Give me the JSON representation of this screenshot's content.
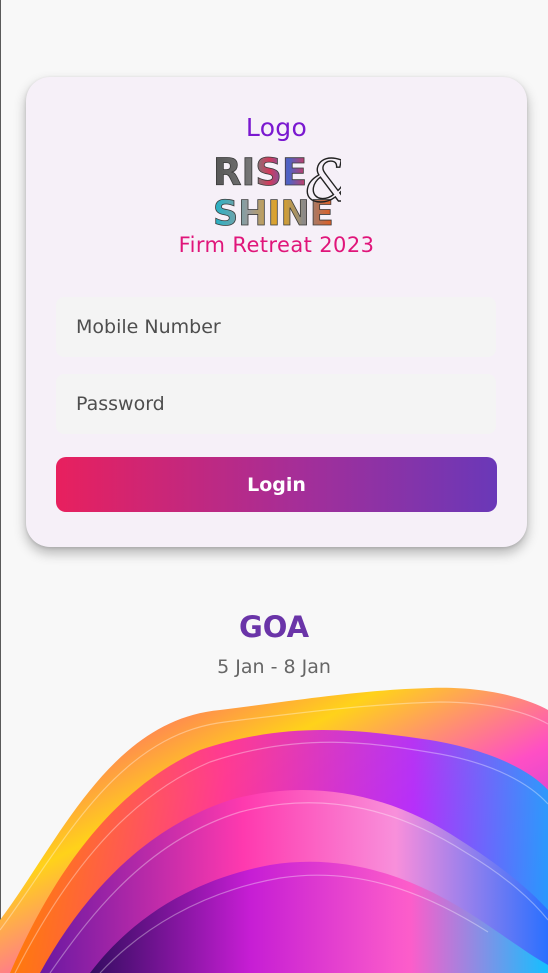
{
  "brand": {
    "logo_text": "Logo",
    "logo_word_1": "RISE",
    "logo_word_2": "SHINE",
    "logo_ampersand": "&",
    "event_title": "Firm Retreat 2023"
  },
  "login_form": {
    "mobile_placeholder": "Mobile Number",
    "mobile_value": "",
    "password_placeholder": "Password",
    "password_value": "",
    "login_label": "Login"
  },
  "event": {
    "location": "GOA",
    "dates": "5 Jan - 8 Jan"
  },
  "colors": {
    "logo_text": "#7a18d0",
    "event_title": "#e0157a",
    "location": "#6a34a8",
    "button_start": "#e8205e",
    "button_end": "#6a38b8"
  },
  "decoration": {
    "background_art": "colorful-abstract-waves-image"
  }
}
